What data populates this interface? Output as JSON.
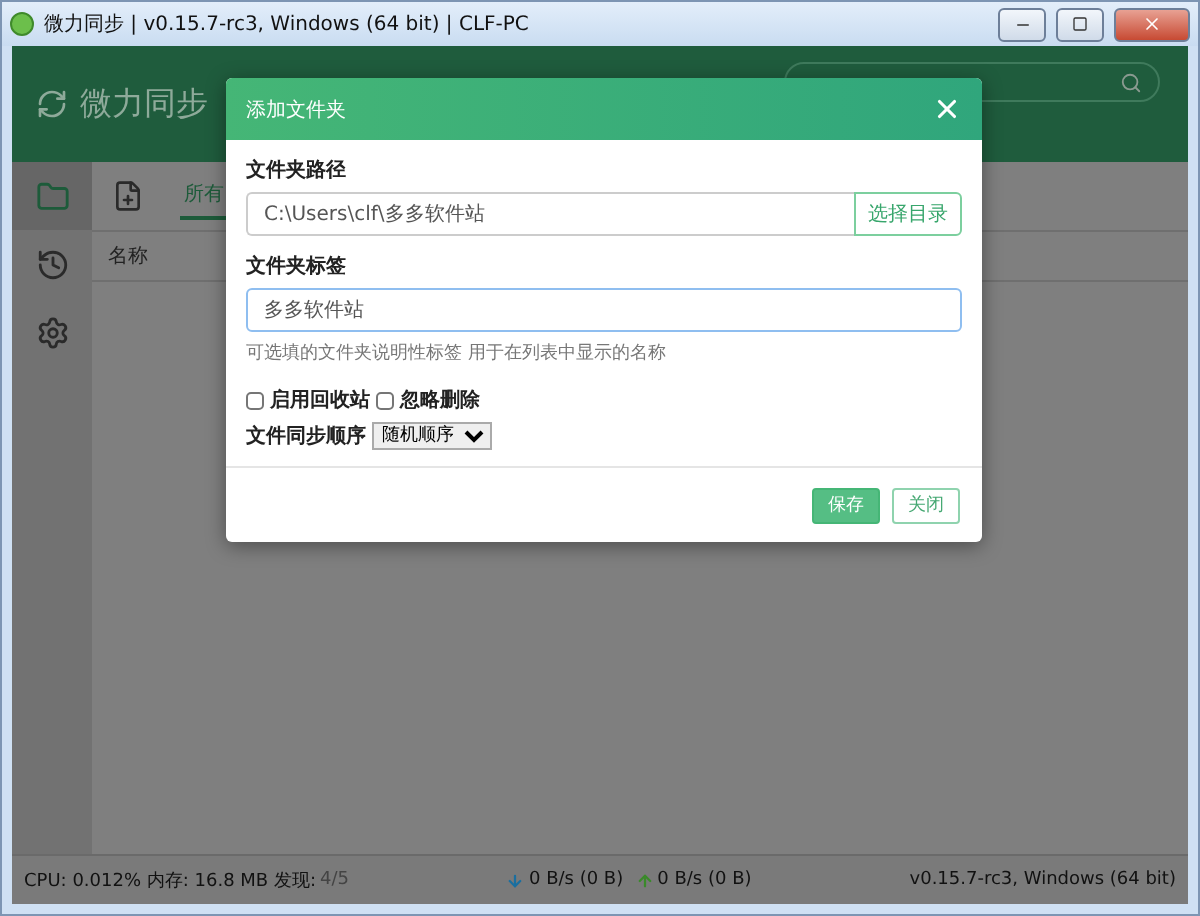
{
  "window": {
    "title": "微力同步 | v0.15.7-rc3, Windows (64 bit) | CLF-PC"
  },
  "header": {
    "brand": "微力同步"
  },
  "sidebar": {
    "items": [
      {
        "selected": true
      },
      {
        "selected": false
      },
      {
        "selected": false
      }
    ]
  },
  "tabs": [
    {
      "label": "所有",
      "selected": true
    }
  ],
  "table": {
    "columns": [
      "名称"
    ]
  },
  "dialog": {
    "title": "添加文件夹",
    "path_label": "文件夹路径",
    "path_value": "C:\\Users\\clf\\多多软件站",
    "browse_button": "选择目录",
    "tag_label": "文件夹标签",
    "tag_value": "多多软件站",
    "hint": "可选填的文件夹说明性标签 用于在列表中显示的名称",
    "checkboxes": [
      {
        "label": "启用回收站",
        "checked": false
      },
      {
        "label": "忽略删除",
        "checked": false
      }
    ],
    "order_label": "文件同步顺序",
    "order_value": "随机顺序",
    "buttons": [
      {
        "label": "保存",
        "kind": "primary"
      },
      {
        "label": "关闭",
        "kind": "secondary"
      }
    ]
  },
  "status_bar": {
    "stats": "CPU: 0.012% 内存: 16.8 MB 发现:",
    "discovery": "4/5",
    "download": "0 B/s (0 B)",
    "upload": "0 B/s (0 B)",
    "version": "v0.15.7-rc3, Windows (64 bit)"
  }
}
